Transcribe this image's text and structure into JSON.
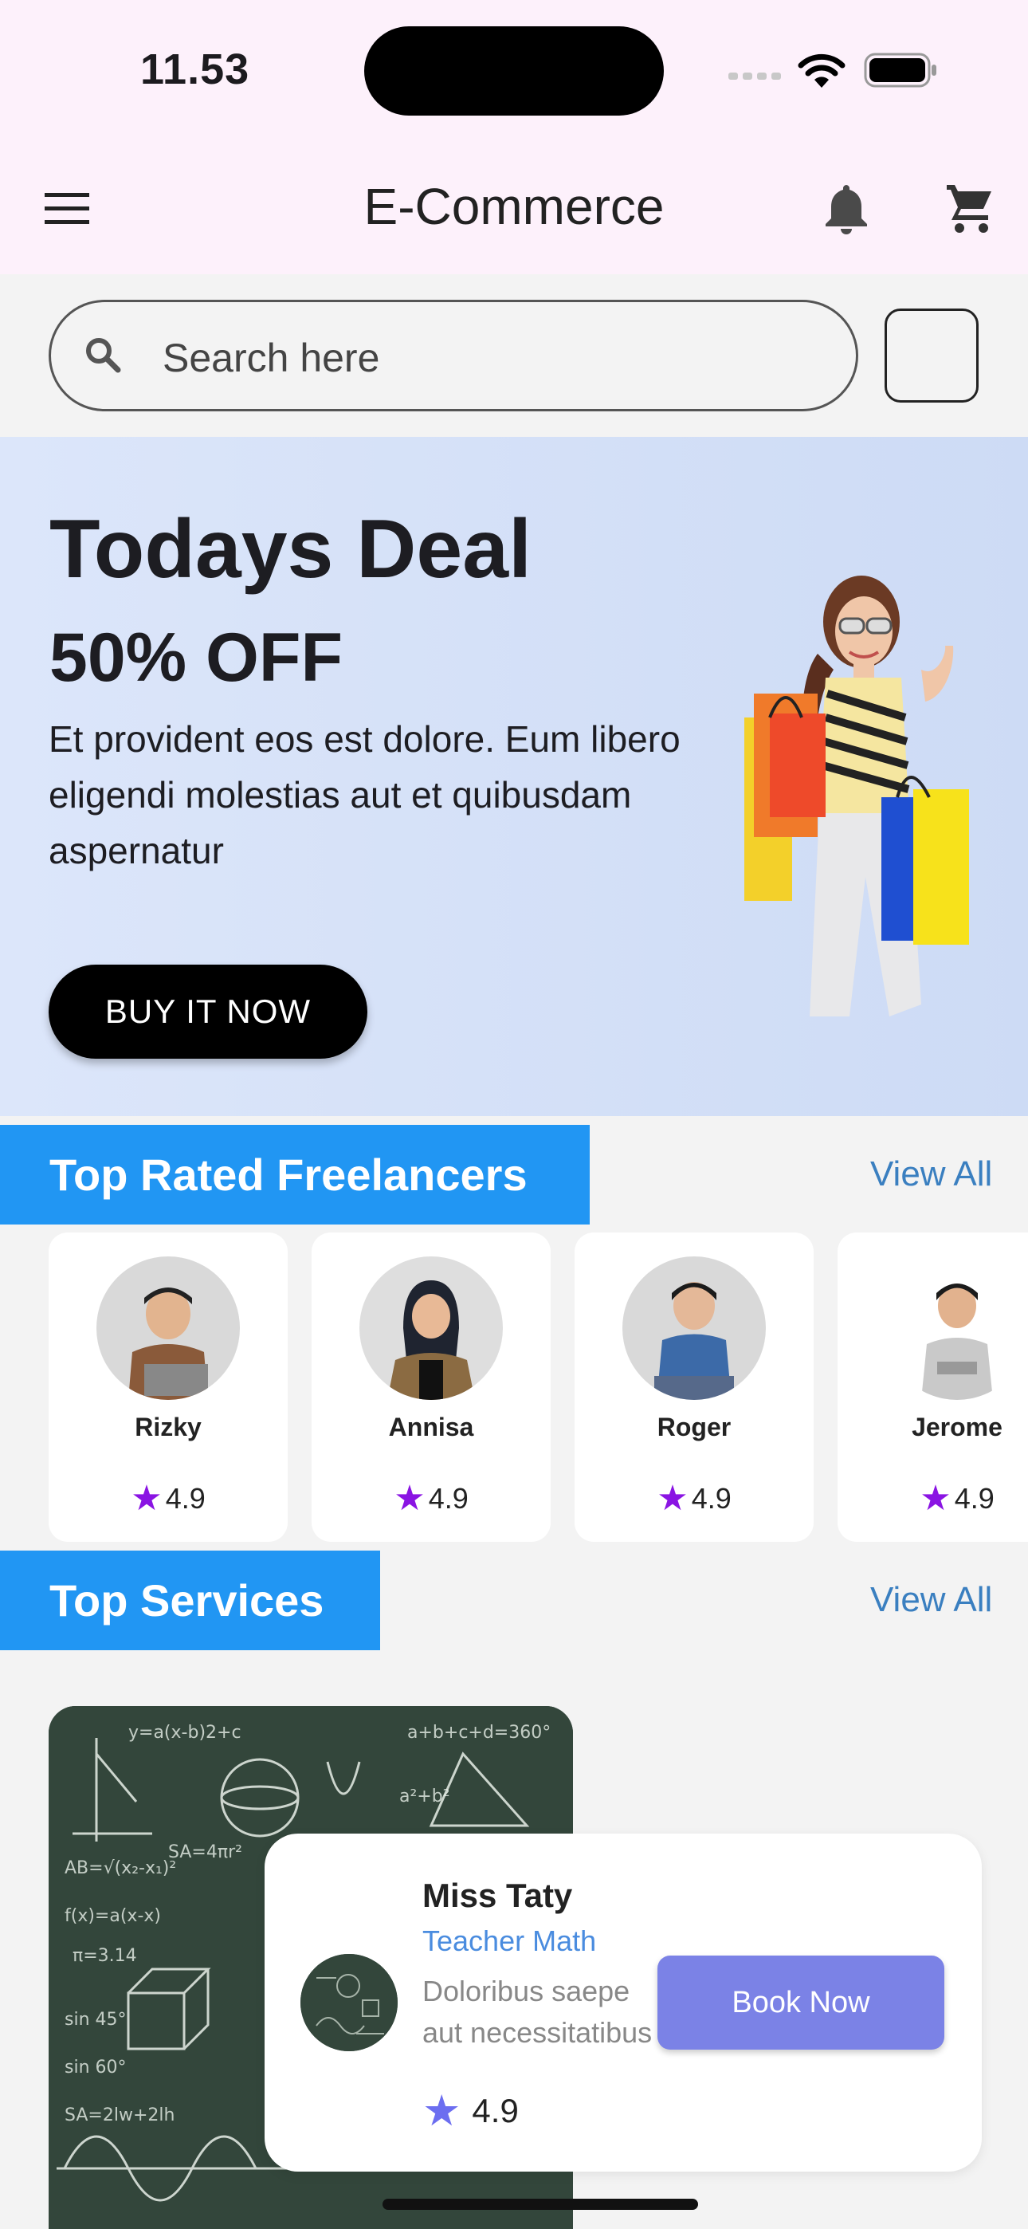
{
  "status_bar": {
    "time": "11.53"
  },
  "app_bar": {
    "title": "E-Commerce",
    "menu_icon": "menu-icon",
    "bell_icon": "bell-icon",
    "cart_icon": "cart-icon"
  },
  "search": {
    "placeholder": "Search here"
  },
  "banner": {
    "title": "Todays Deal",
    "discount": "50% OFF",
    "description": "Et provident eos est dolore. Eum libero\neligendi molestias aut et quibusdam aspernatur",
    "button_label": "BUY IT NOW"
  },
  "freelancers_section": {
    "title": "Top Rated Freelancers",
    "view_all": "View All",
    "items": [
      {
        "name": "Rizky",
        "rating": "4.9"
      },
      {
        "name": "Annisa",
        "rating": "4.9"
      },
      {
        "name": "Roger",
        "rating": "4.9"
      },
      {
        "name": "Jerome",
        "rating": "4.9"
      }
    ]
  },
  "services_section": {
    "title": "Top Services",
    "view_all": "View All",
    "service": {
      "name": "Miss Taty",
      "role": "Teacher Math",
      "description": "Doloribus saepe aut necessitatibus",
      "rating": "4.9",
      "button_label": "Book Now"
    }
  },
  "colors": {
    "accent": "#2196f3",
    "rating_star": "#8a14e3",
    "book_button": "#7b82e6"
  }
}
